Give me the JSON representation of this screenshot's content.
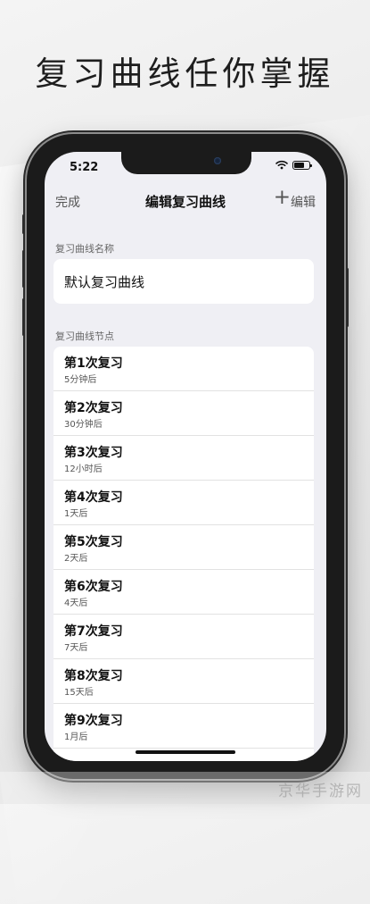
{
  "headline": "复习曲线任你掌握",
  "status_bar": {
    "time": "5:22",
    "battery_level": 0.7
  },
  "navbar": {
    "done_label": "完成",
    "title": "编辑复习曲线",
    "add_label": "+",
    "edit_label": "编辑"
  },
  "curve_name": {
    "section_label": "复习曲线名称",
    "value": "默认复习曲线"
  },
  "nodes": {
    "section_label": "复习曲线节点",
    "items": [
      {
        "title": "第1次复习",
        "subtitle": "5分钟后"
      },
      {
        "title": "第2次复习",
        "subtitle": "30分钟后"
      },
      {
        "title": "第3次复习",
        "subtitle": "12小时后"
      },
      {
        "title": "第4次复习",
        "subtitle": "1天后"
      },
      {
        "title": "第5次复习",
        "subtitle": "2天后"
      },
      {
        "title": "第6次复习",
        "subtitle": "4天后"
      },
      {
        "title": "第7次复习",
        "subtitle": "7天后"
      },
      {
        "title": "第8次复习",
        "subtitle": "15天后"
      },
      {
        "title": "第9次复习",
        "subtitle": "1月后"
      }
    ]
  },
  "watermark": "京华手游网"
}
